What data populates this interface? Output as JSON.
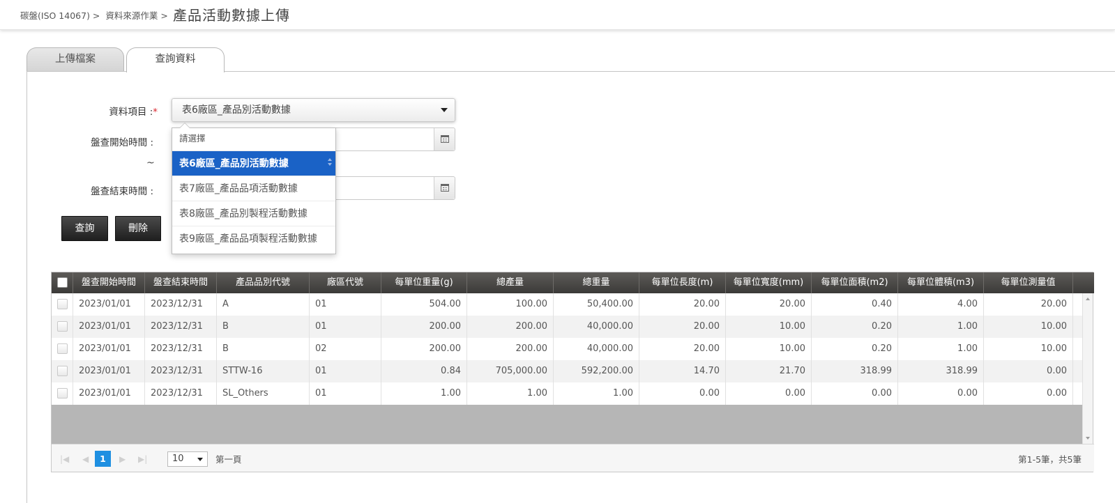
{
  "breadcrumb": {
    "items": [
      "碳盤(ISO 14067) >",
      "資料來源作業 >"
    ],
    "title": "產品活動數據上傳"
  },
  "tabs": [
    {
      "label": "上傳檔案",
      "active": false
    },
    {
      "label": "查詢資料",
      "active": true
    }
  ],
  "form": {
    "item_label": "資料項目 :",
    "required_mark": "*",
    "selected_item": "表6廠區_產品別活動數據",
    "start_label": "盤查開始時間 :",
    "tilde": "~",
    "end_label": "盤查結束時間 :",
    "start_value": "",
    "end_value": "",
    "dropdown_options": [
      "請選擇",
      "表6廠區_產品別活動數據",
      "表7廠區_產品品項活動數據",
      "表8廠區_產品別製程活動數據",
      "表9廠區_產品品項製程活動數據"
    ],
    "query_button": "查詢",
    "delete_button": "刪除"
  },
  "grid": {
    "columns": [
      "盤查開始時間",
      "盤查結束時間",
      "產品品別代號",
      "廠區代號",
      "每單位重量(g)",
      "總產量",
      "總重量",
      "每單位長度(m)",
      "每單位寬度(mm)",
      "每單位面積(m2)",
      "每單位體積(m3)",
      "每單位測量值"
    ],
    "rows": [
      [
        "2023/01/01",
        "2023/12/31",
        "A",
        "01",
        "504.00",
        "100.00",
        "50,400.00",
        "20.00",
        "20.00",
        "0.40",
        "4.00",
        "20.00"
      ],
      [
        "2023/01/01",
        "2023/12/31",
        "B",
        "01",
        "200.00",
        "200.00",
        "40,000.00",
        "20.00",
        "10.00",
        "0.20",
        "1.00",
        "10.00"
      ],
      [
        "2023/01/01",
        "2023/12/31",
        "B",
        "02",
        "200.00",
        "200.00",
        "40,000.00",
        "20.00",
        "10.00",
        "0.20",
        "1.00",
        "10.00"
      ],
      [
        "2023/01/01",
        "2023/12/31",
        "STTW-16",
        "01",
        "0.84",
        "705,000.00",
        "592,200.00",
        "14.70",
        "21.70",
        "318.99",
        "318.99",
        "0.00"
      ],
      [
        "2023/01/01",
        "2023/12/31",
        "SL_Others",
        "01",
        "1.00",
        "1.00",
        "1.00",
        "0.00",
        "0.00",
        "0.00",
        "0.00",
        "0.00"
      ]
    ]
  },
  "pager": {
    "current_page": "1",
    "page_size": "10",
    "page_text": "第一頁",
    "summary": "第1-5筆，共5筆"
  },
  "colors": {
    "accent": "#1a62c6",
    "pager_active": "#1e8fe1",
    "header_dark": "#3b3a38",
    "required": "#d9262e"
  }
}
